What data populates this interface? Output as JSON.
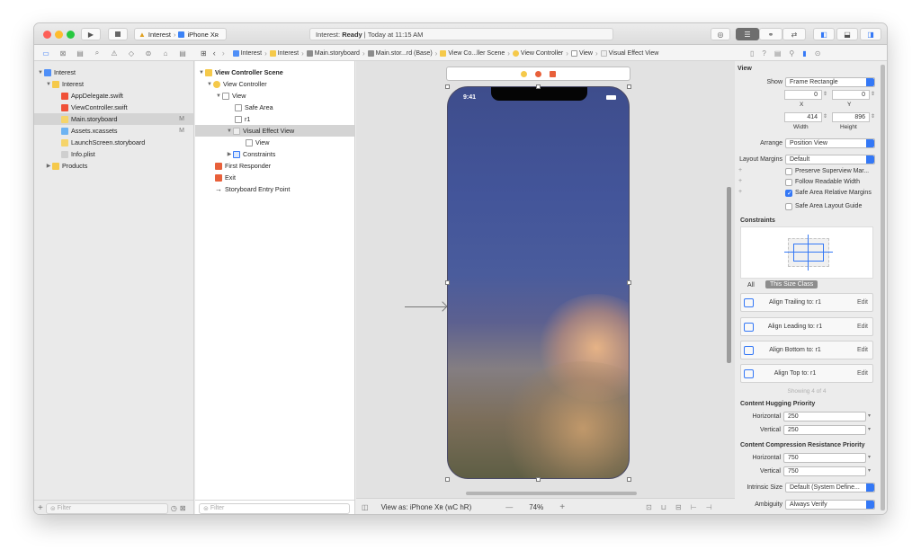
{
  "toolbar": {
    "scheme_target": "Interest",
    "scheme_device": "iPhone Xʀ",
    "status_prefix": "Interest:",
    "status_state": "Ready",
    "status_time": "Today at 11:15 AM"
  },
  "jumpbar": [
    "Interest",
    "Interest",
    "Main.storyboard",
    "Main.stor...rd (Base)",
    "View Co...ller Scene",
    "View Controller",
    "View",
    "Visual Effect View"
  ],
  "navigator": {
    "project": "Interest",
    "group": "Interest",
    "files": [
      {
        "name": "AppDelegate.swift",
        "mark": ""
      },
      {
        "name": "ViewController.swift",
        "mark": ""
      },
      {
        "name": "Main.storyboard",
        "mark": "M"
      },
      {
        "name": "Assets.xcassets",
        "mark": "M"
      },
      {
        "name": "LaunchScreen.storyboard",
        "mark": ""
      },
      {
        "name": "Info.plist",
        "mark": ""
      }
    ],
    "products": "Products",
    "filter_placeholder": "Filter"
  },
  "outline": {
    "scene": "View Controller Scene",
    "view_controller": "View Controller",
    "view": "View",
    "safe_area": "Safe Area",
    "r1": "r1",
    "visual_effect_view": "Visual Effect View",
    "inner_view": "View",
    "constraints": "Constraints",
    "first_responder": "First Responder",
    "exit": "Exit",
    "entry_point": "Storyboard Entry Point",
    "filter_placeholder": "Filter"
  },
  "canvas": {
    "status_time": "9:41",
    "view_as": "View as: iPhone Xʀ (wC hR)",
    "zoom": "74%",
    "zoom_minus": "—",
    "zoom_plus": "+"
  },
  "inspector": {
    "section_title": "View",
    "show_label": "Show",
    "show_value": "Frame Rectangle",
    "x": "0",
    "y": "0",
    "x_label": "X",
    "y_label": "Y",
    "width": "414",
    "height": "896",
    "width_label": "Width",
    "height_label": "Height",
    "arrange_label": "Arrange",
    "arrange_value": "Position View",
    "layout_margins_label": "Layout Margins",
    "layout_margins_value": "Default",
    "opt_preserve": "Preserve Superview Mar...",
    "opt_follow": "Follow Readable Width",
    "opt_safe_rel": "Safe Area Relative Margins",
    "opt_safe_guide": "Safe Area Layout Guide",
    "constraints_title": "Constraints",
    "size_all": "All",
    "size_this": "This Size Class",
    "constraints": [
      {
        "label": "Align Trailing to:  r1",
        "edit": "Edit"
      },
      {
        "label": "Align Leading to:  r1",
        "edit": "Edit"
      },
      {
        "label": "Align Bottom to:  r1",
        "edit": "Edit"
      },
      {
        "label": "Align Top to:  r1",
        "edit": "Edit"
      }
    ],
    "showing": "Showing 4 of 4",
    "hugging_title": "Content Hugging Priority",
    "horizontal_label": "Horizontal",
    "vertical_label": "Vertical",
    "hug_h": "250",
    "hug_v": "250",
    "compression_title": "Content Compression Resistance Priority",
    "comp_h": "750",
    "comp_v": "750",
    "intrinsic_label": "Intrinsic Size",
    "intrinsic_value": "Default (System Define...",
    "ambiguity_label": "Ambiguity",
    "ambiguity_value": "Always Verify"
  },
  "colors": {
    "accent": "#3478f6",
    "folder": "#f5c94a",
    "swift": "#f05138",
    "selection": "#d4d4d4"
  }
}
